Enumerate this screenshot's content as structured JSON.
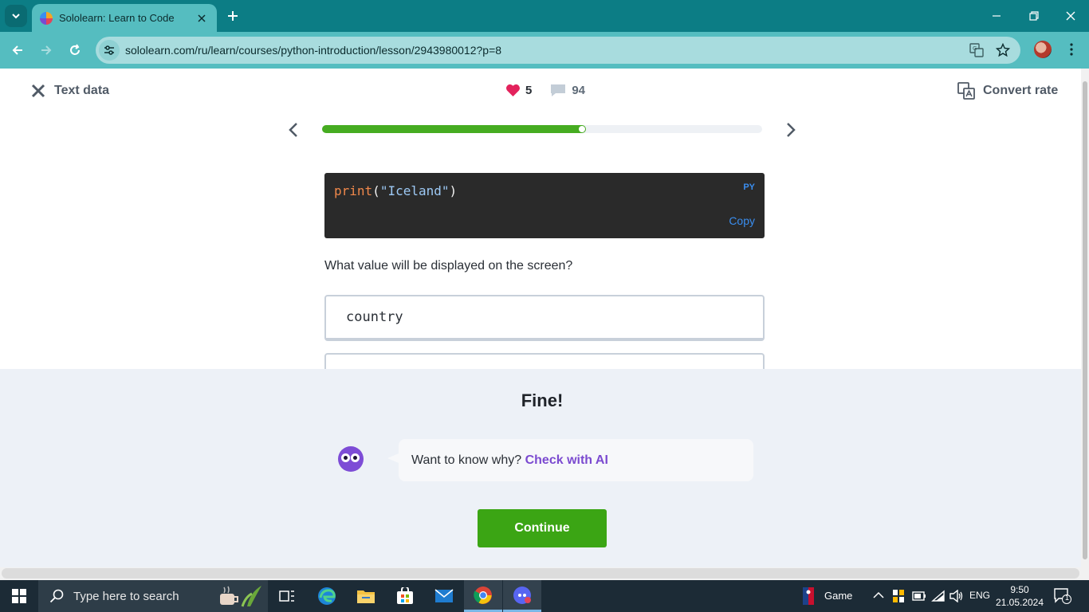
{
  "browser": {
    "tab_title": "Sololearn: Learn to Code",
    "url": "sololearn.com/ru/learn/courses/python-introduction/lesson/2943980012?p=8",
    "frame_color": "#0c7d85",
    "toolbar_color": "#55bdc0"
  },
  "lesson": {
    "title": "Text data",
    "hearts": "5",
    "comments": "94",
    "convert_label": "Convert rate",
    "progress_fraction": 0.6
  },
  "code": {
    "fn": "print",
    "open": "(",
    "str": "\"Iceland\"",
    "close": ")",
    "lang": "PY",
    "copy_label": "Copy"
  },
  "question": "What value will be displayed on the screen?",
  "answer": "country",
  "feedback": {
    "title": "Fine!",
    "prompt": "Want to know why?",
    "link": "Check with AI",
    "continue_label": "Continue",
    "accent_green": "#3ba514",
    "accent_purple": "#7b4ad0"
  },
  "taskbar": {
    "search_placeholder": "Type here to search",
    "game_label": "Game",
    "lang": "ENG",
    "time": "9:50",
    "date": "21.05.2024",
    "notifications": "1"
  }
}
